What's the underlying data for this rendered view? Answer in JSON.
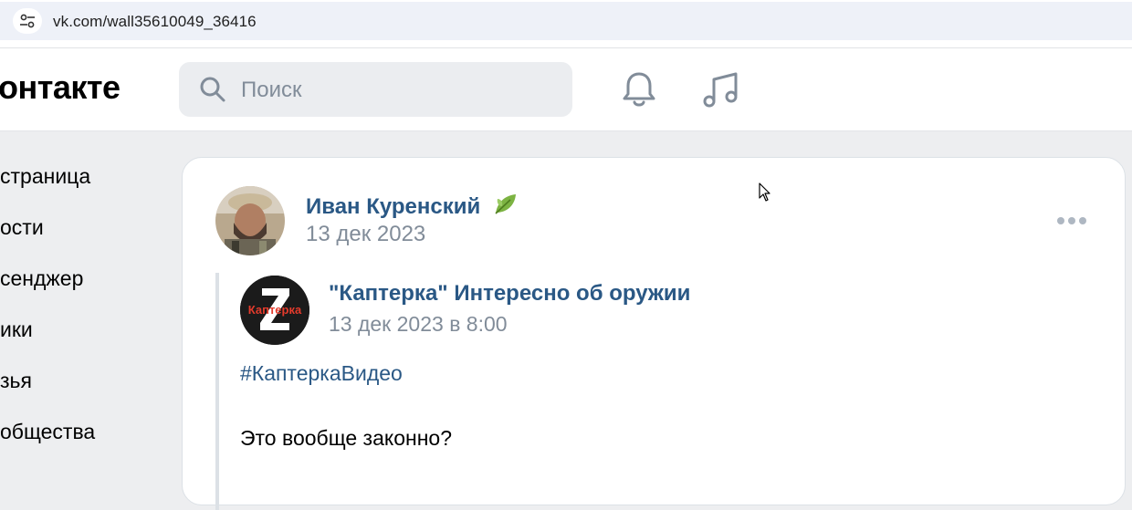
{
  "browser": {
    "url": "vk.com/wall35610049_36416",
    "site_icon": "tune-icon"
  },
  "header": {
    "logo_text": "онтакте",
    "search": {
      "placeholder": "Поиск",
      "value": ""
    },
    "icons": [
      "bell-icon",
      "music-icon"
    ]
  },
  "sidebar": {
    "items": [
      {
        "label": "страница"
      },
      {
        "label": "ости"
      },
      {
        "label": "сенджер"
      },
      {
        "label": "ики"
      },
      {
        "label": "зья"
      },
      {
        "label": "общества"
      }
    ]
  },
  "post": {
    "author": "Иван Куренский",
    "date": "13 дек 2023",
    "repost": {
      "group_name": "\"Каптерка\" Интересно об оружии",
      "group_avatar_text": "Каптерка",
      "date": "13 дек 2023 в 8:00",
      "hashtag": "#КаптеркаВидео",
      "text": "Это вообще законно?"
    }
  },
  "colors": {
    "link": "#2a5885",
    "muted": "#818c99",
    "background": "#edeef0"
  }
}
